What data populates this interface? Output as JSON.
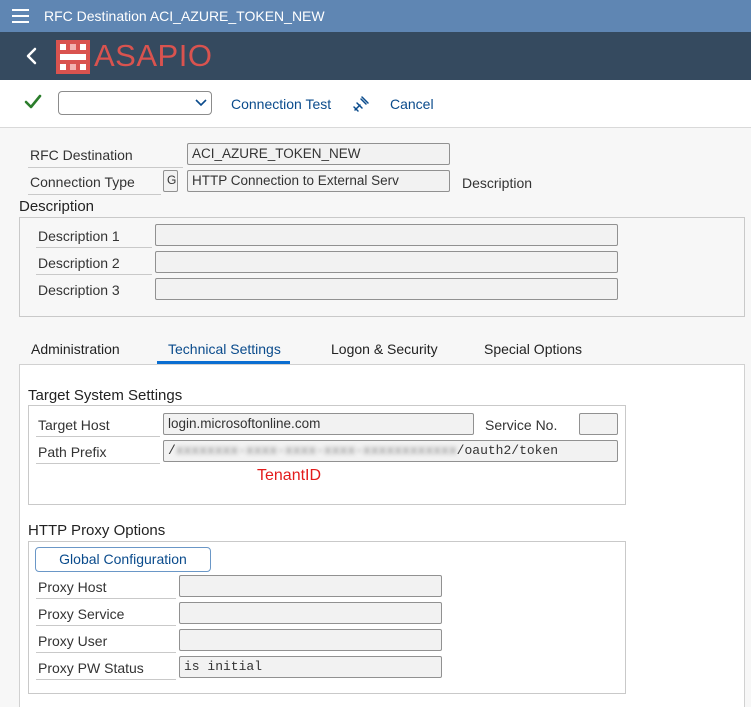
{
  "window": {
    "title": "RFC Destination ACI_AZURE_TOKEN_NEW"
  },
  "brand": {
    "logo_text": "ASAPIO"
  },
  "toolbar": {
    "dropdown_value": "",
    "connection_test_label": "Connection Test",
    "cancel_label": "Cancel"
  },
  "header": {
    "rfc_destination_label": "RFC Destination",
    "rfc_destination_value": "ACI_AZURE_TOKEN_NEW",
    "connection_type_label": "Connection Type",
    "connection_type_code": "G",
    "connection_type_value": "HTTP Connection to External Serv",
    "description_caption": "Description"
  },
  "description": {
    "title": "Description",
    "rows": [
      {
        "label": "Description 1",
        "value": ""
      },
      {
        "label": "Description 2",
        "value": ""
      },
      {
        "label": "Description 3",
        "value": ""
      }
    ]
  },
  "tabs": [
    {
      "label": "Administration",
      "active": false
    },
    {
      "label": "Technical Settings",
      "active": true
    },
    {
      "label": "Logon & Security",
      "active": false
    },
    {
      "label": "Special Options",
      "active": false
    }
  ],
  "target_system": {
    "title": "Target System Settings",
    "target_host_label": "Target Host",
    "target_host_value": "login.microsoftonline.com",
    "service_no_label": "Service No.",
    "service_no_value": "",
    "path_prefix_label": "Path Prefix",
    "path_prefix_start": "/",
    "path_prefix_redacted": "xxxxxxxx-xxxx-xxxx-xxxx-xxxxxxxxxxxx",
    "path_prefix_end": "/oauth2/token",
    "annotation": "TenantID"
  },
  "proxy": {
    "title": "HTTP Proxy Options",
    "global_config_label": "Global Configuration",
    "rows": [
      {
        "label": "Proxy Host",
        "value": ""
      },
      {
        "label": "Proxy Service",
        "value": ""
      },
      {
        "label": "Proxy User",
        "value": ""
      },
      {
        "label": "Proxy PW Status",
        "value": "is initial"
      }
    ]
  },
  "colors": {
    "title_bar": "#5f86b3",
    "brand_bar": "#354a5f",
    "logo": "#d9534f",
    "link": "#0a4b8c",
    "annotation": "#e31b1b",
    "check": "#2b7d2b"
  }
}
